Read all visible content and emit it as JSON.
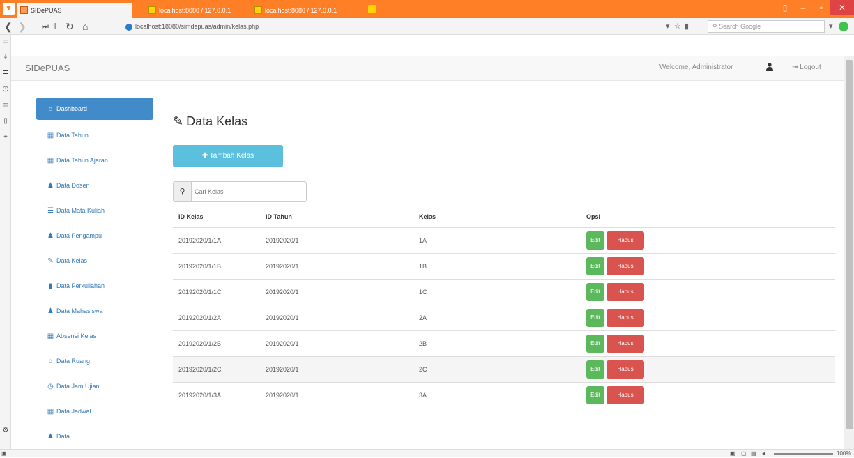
{
  "browser": {
    "tabs": [
      {
        "label": "SIDePUAS"
      },
      {
        "label": "localhost:8080 / 127.0.0.1"
      },
      {
        "label": "localhost:8080 / 127.0.0.1"
      }
    ],
    "url": "localhost:18080/simdepuas/admin/kelas.php",
    "search_placeholder": "Search Google",
    "zoom": "100%"
  },
  "app": {
    "brand": "SIDePUAS",
    "welcome": "Welcome, Administrator",
    "logout": "Logout"
  },
  "sidebar": {
    "items": [
      {
        "label": "Dashboard",
        "icon": "home-icon",
        "glyph": "⌂"
      },
      {
        "label": "Data Tahun",
        "icon": "table-icon",
        "glyph": "▦"
      },
      {
        "label": "Data Tahun Ajaran",
        "icon": "table-icon",
        "glyph": "▦"
      },
      {
        "label": "Data Dosen",
        "icon": "user-icon",
        "glyph": "♟"
      },
      {
        "label": "Data Mata Kuliah",
        "icon": "list-icon",
        "glyph": "☰"
      },
      {
        "label": "Data Pengampu",
        "icon": "user-icon",
        "glyph": "♟"
      },
      {
        "label": "Data Kelas",
        "icon": "pushpin-icon",
        "glyph": "✎"
      },
      {
        "label": "Data Perkuliahan",
        "icon": "book-icon",
        "glyph": "▮"
      },
      {
        "label": "Data Mahasiswa",
        "icon": "user-icon",
        "glyph": "♟"
      },
      {
        "label": "Absensi Kelas",
        "icon": "grid-icon",
        "glyph": "▦"
      },
      {
        "label": "Data Ruang",
        "icon": "home-icon",
        "glyph": "⌂"
      },
      {
        "label": "Data Jam Ujian",
        "icon": "clock-icon",
        "glyph": "◷"
      },
      {
        "label": "Data Jadwal",
        "icon": "table-icon",
        "glyph": "▦"
      },
      {
        "label": "Data",
        "icon": "user-icon",
        "glyph": "♟"
      }
    ]
  },
  "main": {
    "title": "Data Kelas",
    "add_button": "Tambah Kelas",
    "search_placeholder": "Cari Kelas",
    "table": {
      "headers": [
        "ID Kelas",
        "ID Tahun",
        "Kelas",
        "Opsi"
      ],
      "rows": [
        [
          "20192020/1/1A",
          "20192020/1",
          "1A"
        ],
        [
          "20192020/1/1B",
          "20192020/1",
          "1B"
        ],
        [
          "20192020/1/1C",
          "20192020/1",
          "1C"
        ],
        [
          "20192020/1/2A",
          "20192020/1",
          "2A"
        ],
        [
          "20192020/1/2B",
          "20192020/1",
          "2B"
        ],
        [
          "20192020/1/2C",
          "20192020/1",
          "2C"
        ],
        [
          "20192020/1/3A",
          "20192020/1",
          "3A"
        ]
      ],
      "edit_label": "Edit",
      "delete_label": "Hapus"
    }
  },
  "colors": {
    "browser_orange": "#ff7f27",
    "sidebar_active": "#428bca",
    "add_button": "#5bc0de",
    "edit_button": "#5cb85c",
    "delete_button": "#d9534f"
  }
}
